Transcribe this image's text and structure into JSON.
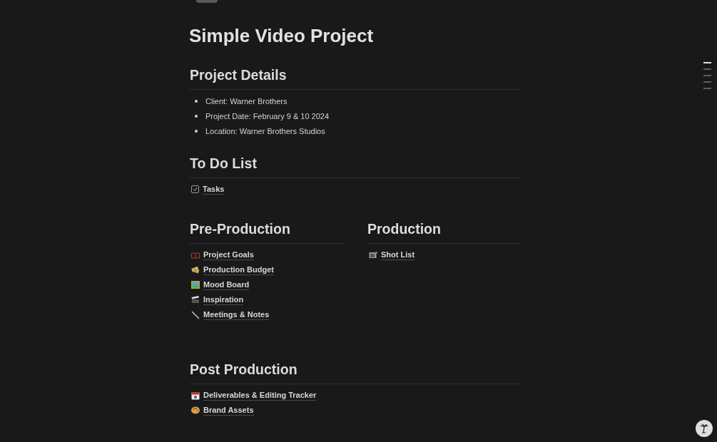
{
  "title": "Simple Video Project",
  "sections": [
    {
      "kind": "bullets",
      "heading": "Project Details",
      "items": [
        "Client: Warner Brothers",
        "Project Date: February 9 & 10 2024",
        "Location: Warner Brothers Studios"
      ]
    },
    {
      "kind": "todo",
      "heading": "To Do List",
      "items": [
        {
          "label": "Tasks",
          "checked": true
        }
      ]
    },
    {
      "kind": "columns",
      "columns": [
        {
          "heading": "Pre-Production",
          "links": [
            "Project Goals",
            "Production Budget",
            "Mood Board",
            "Inspiration",
            "Meetings & Notes"
          ]
        },
        {
          "heading": "Production",
          "links": [
            "Shot List"
          ]
        }
      ]
    },
    {
      "kind": "links",
      "heading": "Post Production",
      "links": [
        "Deliverables & Editing Tracker",
        "Brand Assets"
      ]
    }
  ],
  "toc": [
    {
      "selected": true
    },
    {
      "selected": false
    },
    {
      "selected": false
    },
    {
      "selected": false
    },
    {
      "selected": false
    }
  ]
}
